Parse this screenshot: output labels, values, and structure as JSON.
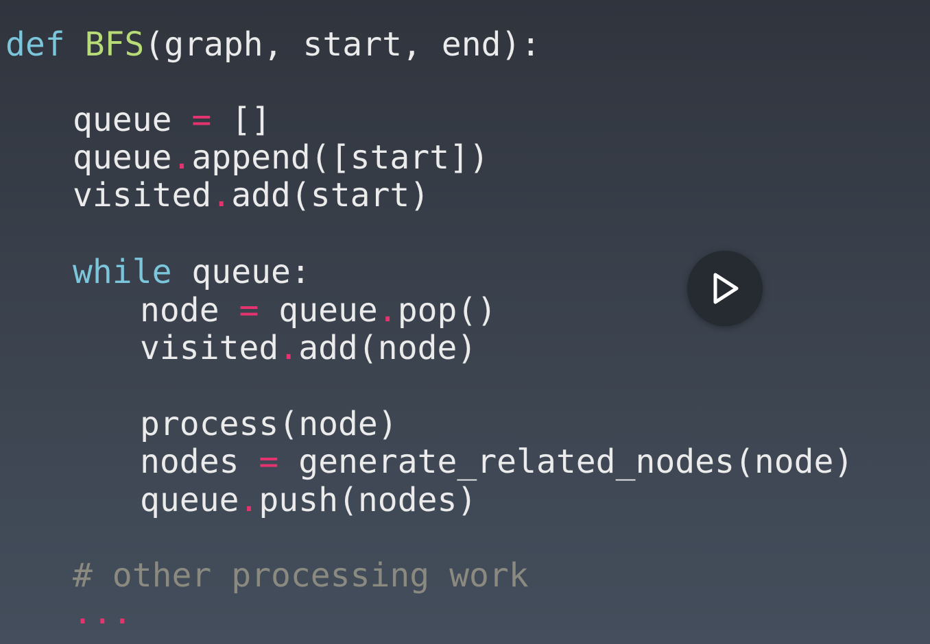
{
  "code": {
    "lines": [
      {
        "indent": 0,
        "tokens": [
          {
            "t": "def",
            "k": "kw"
          },
          {
            "t": " ",
            "k": "tx"
          },
          {
            "t": "BFS",
            "k": "fn"
          },
          {
            "t": "(graph, start, end):",
            "k": "tx"
          }
        ]
      },
      {
        "indent": 1,
        "tokens": [
          {
            "t": "queue ",
            "k": "tx"
          },
          {
            "t": "=",
            "k": "op"
          },
          {
            "t": " []",
            "k": "tx"
          }
        ]
      },
      {
        "indent": 1,
        "tokens": [
          {
            "t": "queue",
            "k": "tx"
          },
          {
            "t": ".",
            "k": "op"
          },
          {
            "t": "append([start])",
            "k": "tx"
          }
        ]
      },
      {
        "indent": 1,
        "tokens": [
          {
            "t": "visited",
            "k": "tx"
          },
          {
            "t": ".",
            "k": "op"
          },
          {
            "t": "add(start)",
            "k": "tx"
          }
        ]
      },
      {
        "indent": 1,
        "tokens": [
          {
            "t": "while",
            "k": "kw"
          },
          {
            "t": " queue:",
            "k": "tx"
          }
        ]
      },
      {
        "indent": 2,
        "tokens": [
          {
            "t": "node ",
            "k": "tx"
          },
          {
            "t": "=",
            "k": "op"
          },
          {
            "t": " queue",
            "k": "tx"
          },
          {
            "t": ".",
            "k": "op"
          },
          {
            "t": "pop()",
            "k": "tx"
          }
        ]
      },
      {
        "indent": 2,
        "tokens": [
          {
            "t": "visited",
            "k": "tx"
          },
          {
            "t": ".",
            "k": "op"
          },
          {
            "t": "add(node)",
            "k": "tx"
          }
        ]
      },
      {
        "indent": 2,
        "tokens": [
          {
            "t": "process(node)",
            "k": "tx"
          }
        ]
      },
      {
        "indent": 2,
        "tokens": [
          {
            "t": "nodes ",
            "k": "tx"
          },
          {
            "t": "=",
            "k": "op"
          },
          {
            "t": " generate_related_nodes(node)",
            "k": "tx"
          }
        ]
      },
      {
        "indent": 2,
        "tokens": [
          {
            "t": "queue",
            "k": "tx"
          },
          {
            "t": ".",
            "k": "op"
          },
          {
            "t": "push(nodes)",
            "k": "tx"
          }
        ]
      },
      {
        "indent": 1,
        "tokens": [
          {
            "t": "# other processing work",
            "k": "cm"
          }
        ]
      },
      {
        "indent": 1,
        "tokens": [
          {
            "t": "...",
            "k": "op"
          }
        ]
      }
    ]
  },
  "player": {
    "play_icon": "play-icon"
  },
  "colors": {
    "keyword": "#7cc6dc",
    "function": "#b7db77",
    "operator": "#e5336f",
    "comment": "#8a8a80",
    "text": "#ebebeb",
    "play_button_bg": "#262a31"
  }
}
